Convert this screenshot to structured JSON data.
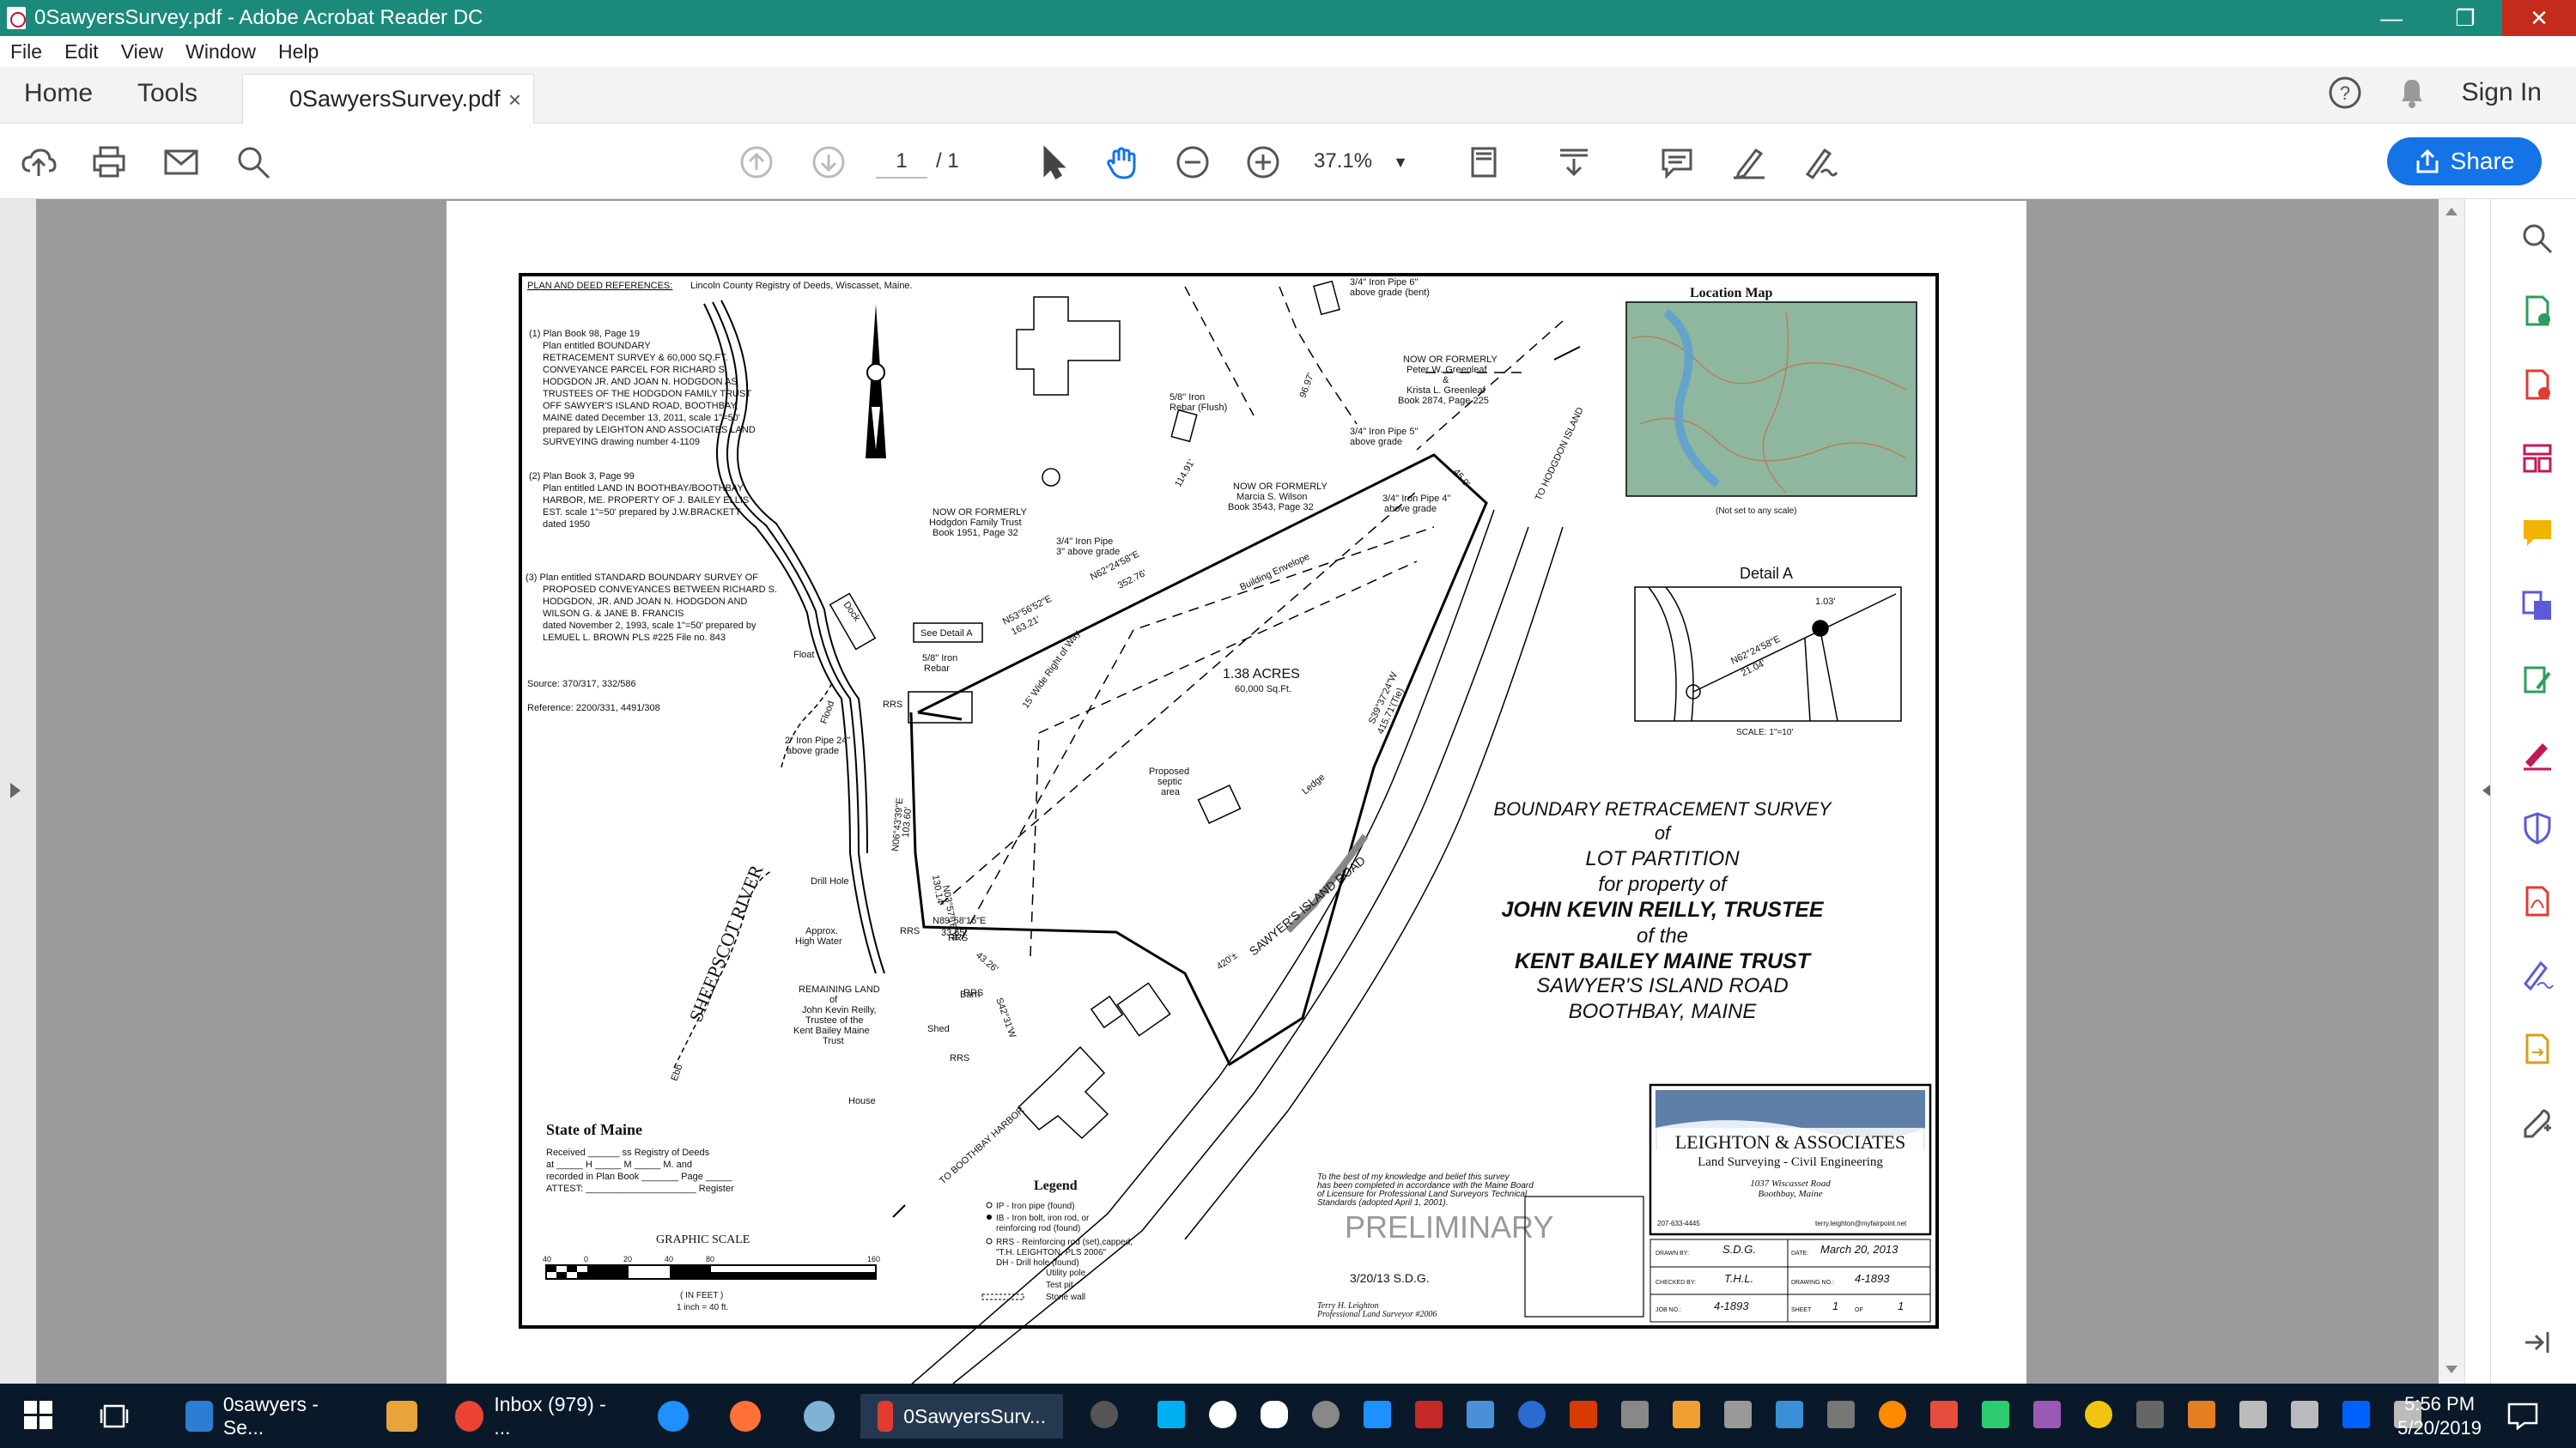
{
  "window": {
    "title": "0SawyersSurvey.pdf - Adobe Acrobat Reader DC",
    "minimize": "—",
    "restore": "❐",
    "close": "✕"
  },
  "menu": [
    "File",
    "Edit",
    "View",
    "Window",
    "Help"
  ],
  "tabs": {
    "home": "Home",
    "tools": "Tools",
    "document": "0SawyersSurvey.pdf",
    "close": "×",
    "sign_in": "Sign In",
    "help": "?"
  },
  "toolbar": {
    "page_current": "1",
    "page_total": "/ 1",
    "zoom": "37.1%",
    "share": "Share"
  },
  "survey": {
    "refs_title": "PLAN AND DEED REFERENCES:",
    "refs_registry": "Lincoln County Registry of Deeds, Wiscasset, Maine.",
    "ref1": [
      "(1) Plan Book 98, Page 19",
      "Plan entitled BOUNDARY",
      "RETRACEMENT SURVEY & 60,000 SQ.FT.",
      "CONVEYANCE PARCEL FOR RICHARD S.",
      "HODGDON JR. AND JOAN N. HODGDON AS",
      "TRUSTEES OF THE HODGDON FAMILY TRUST",
      "OFF SAWYER'S ISLAND ROAD, BOOTHBAY,",
      "MAINE dated December 13, 2011, scale 1\"=50'",
      "prepared by LEIGHTON AND ASSOCIATES LAND",
      "SURVEYING drawing number 4-1109"
    ],
    "ref2": [
      "(2) Plan Book 3, Page 99",
      "Plan entitled LAND IN BOOTHBAY/BOOTHBAY",
      "HARBOR, ME. PROPERTY OF J. BAILEY ELLIS",
      "EST. scale 1\"=50' prepared by J.W.BRACKETT",
      "dated 1950"
    ],
    "ref3": [
      "(3) Plan entitled STANDARD BOUNDARY SURVEY OF",
      "PROPOSED CONVEYANCES BETWEEN RICHARD S.",
      "HODGDON, JR. AND JOAN N. HODGDON AND",
      "WILSON G. & JANE B. FRANCIS",
      "dated November 2, 1993, scale 1\"=50' prepared by",
      "LEMUEL L. BROWN PLS #225 File no. 843"
    ],
    "source": "Source:     370/317, 332/586",
    "reference": "Reference:     2200/331, 4491/308",
    "location_map_title": "Location Map",
    "location_map_note": "(Not set to any scale)",
    "detail_title": "Detail A",
    "detail_scale": "SCALE:  1\"=10'",
    "detail_dist": "1.03'",
    "detail_bearing": "N62°24'58\"E",
    "detail_len": "21.04'",
    "acres": "1.38 ACRES",
    "sqft": "60,000 Sq.Ft.",
    "title_lines": [
      "BOUNDARY  RETRACEMENT  SURVEY",
      "of",
      "LOT  PARTITION",
      "for  property  of",
      "JOHN  KEVIN  REILLY,  TRUSTEE",
      "of  the",
      "KENT  BAILEY  MAINE  TRUST",
      "SAWYER'S  ISLAND  ROAD",
      "BOOTHBAY,  MAINE"
    ],
    "river": "SHEEPSCOT  RIVER",
    "road": "SAWYER'S  ISLAND  ROAD",
    "to_hodgdon": "TO  HODGDON  ISLAND",
    "to_boothbay": "TO  BOOTHBAY  HARBOR",
    "labels": {
      "pipe6": "3/4\" Iron Pipe 6\"",
      "pipe6b": "above grade (bent)",
      "greenleaf1": "NOW OR FORMERLY",
      "greenleaf2": "Peter W. Greenleaf",
      "greenleaf3": "&",
      "greenleaf4": "Krista L. Greenleaf",
      "greenleaf5": "Book 2874, Page 225",
      "rebar_flush1": "5/8\" Iron",
      "rebar_flush2": "Rebar (Flush)",
      "pipe5": "3/4\" Iron Pipe 5\"",
      "pipe5b": "above grade",
      "wilson1": "NOW OR FORMERLY",
      "wilson2": "Marcia S. Wilson",
      "wilson3": "Book 3543, Page 32",
      "pipe4": "3/4\" Iron Pipe 4\"",
      "pipe4b": "above grade",
      "hodgdon1": "NOW OR FORMERLY",
      "hodgdon2": "Hodgdon Family Trust",
      "hodgdon3": "Book 1951, Page 32",
      "pipe3": "3/4\" Iron Pipe",
      "pipe3b": "3\" above grade",
      "see_detail": "See Detail A",
      "rebar1": "5/8\" Iron",
      "rebar2": "Rebar",
      "float": "Float",
      "dock": "Dock",
      "pipe24": "2\" Iron Pipe 24\"",
      "pipe24b": "above grade",
      "flood": "Flood",
      "ebb": "Ebb",
      "drill": "Drill Hole",
      "high_water1": "Approx.",
      "high_water2": "High Water",
      "septic1": "Proposed",
      "septic2": "septic",
      "septic3": "area",
      "ledge": "Ledge",
      "bldg_env": "Building Envelope",
      "row": "15' Wide Right of Way",
      "remaining1": "REMAINING LAND",
      "remaining2": "of",
      "remaining3": "John Kevin Reilly,",
      "remaining4": "Trustee of the",
      "remaining5": "Kent Bailey Maine",
      "remaining6": "Trust",
      "barn": "Barn",
      "shed": "Shed",
      "house": "House",
      "rrs": "RRS",
      "dist_420": "420'±",
      "b1": "N62°24'58\"E",
      "b1d": "352.76'",
      "b2": "N53°56'52\"E",
      "b2d": "163.21'",
      "b3": "S39°37'24\"W",
      "b3d": "415.71'(Tie)",
      "b4": "N06°43'39\"E",
      "b4d": "103.60'",
      "b5": "N03°57'16\"W",
      "b5d": "130.14'",
      "b6": "N89°58'16\"E",
      "b6d": "33.65'",
      "b7": "43.26'",
      "b8": "S42°31'W"
    },
    "state_title": "State  of  Maine",
    "state_lines": [
      "Received ______ ss Registry of Deeds",
      "at _____ H _____ M _____ M. and",
      "recorded in Plan Book _______ Page _____",
      "ATTEST: _____________________ Register"
    ],
    "graphic_scale": "GRAPHIC  SCALE",
    "scale_ticks": [
      "40",
      "0",
      "20",
      "40",
      "80",
      "160"
    ],
    "scale_note1": "( IN FEET )",
    "scale_note2": "1 inch = 40  ft.",
    "legend_title": "Legend",
    "legend": [
      "IP  -  Iron pipe (found)",
      "IB  -  Iron bolt, iron rod, or",
      "        reinforcing rod (found)",
      "RRS  -  Reinforcing rod (set),capped,",
      "        \"T.H. LEIGHTON, PLS 2006\"",
      "DH  -  Drill hole (found)",
      "Utility pole",
      "Test pit",
      "Stone wall"
    ],
    "cert_lines": [
      "To the best of my knowledge and belief this survey",
      "has been completed in accordance with the Maine Board",
      "of Licensure for Professional Land Surveyors Technical",
      "Standards (adopted April 1, 2001)."
    ],
    "preliminary": "PRELIMINARY",
    "sig_date": "3/20/13   S.D.G.",
    "surveyor1": "Terry H. Leighton",
    "surveyor2": "Professional Land Surveyor #2006",
    "firm1": "LEIGHTON  &  ASSOCIATES",
    "firm2": "Land Surveying - Civil Engineering",
    "firm3": "1037 Wiscasset Road",
    "firm4": "Boothbay, Maine",
    "firm_phone": "207-633-4445",
    "firm_email": "terry.leighton@myfairpoint.net",
    "drawn_by_label": "DRAWN BY:",
    "drawn_by": "S.D.G.",
    "date_label": "DATE:",
    "date": "March  20,  2013",
    "checked_label": "CHECKED BY:",
    "checked": "T.H.L.",
    "drawing_label": "DRAWING NO.:",
    "drawing_no": "4-1893",
    "job_label": "JOB NO.:",
    "job_no": "4-1893",
    "sheet_label": "SHEET",
    "sheet_no": "1",
    "of_label": "OF",
    "sheet_total": "1"
  },
  "taskbar": {
    "apps": [
      {
        "label": "0sawyers - Se...",
        "color": "#2d7dd2"
      },
      {
        "label": "",
        "color": "#e8a33d"
      },
      {
        "label": "Inbox (979) - ...",
        "color": "#ea4335"
      },
      {
        "label": "",
        "color": "#1e90ff"
      },
      {
        "label": "",
        "color": "#ff7139"
      },
      {
        "label": "",
        "color": "#7fb3d5"
      },
      {
        "label": "0SawyersSurv...",
        "color": "#e03c31"
      }
    ],
    "time": "5:56 PM",
    "date": "5/20/2019"
  }
}
